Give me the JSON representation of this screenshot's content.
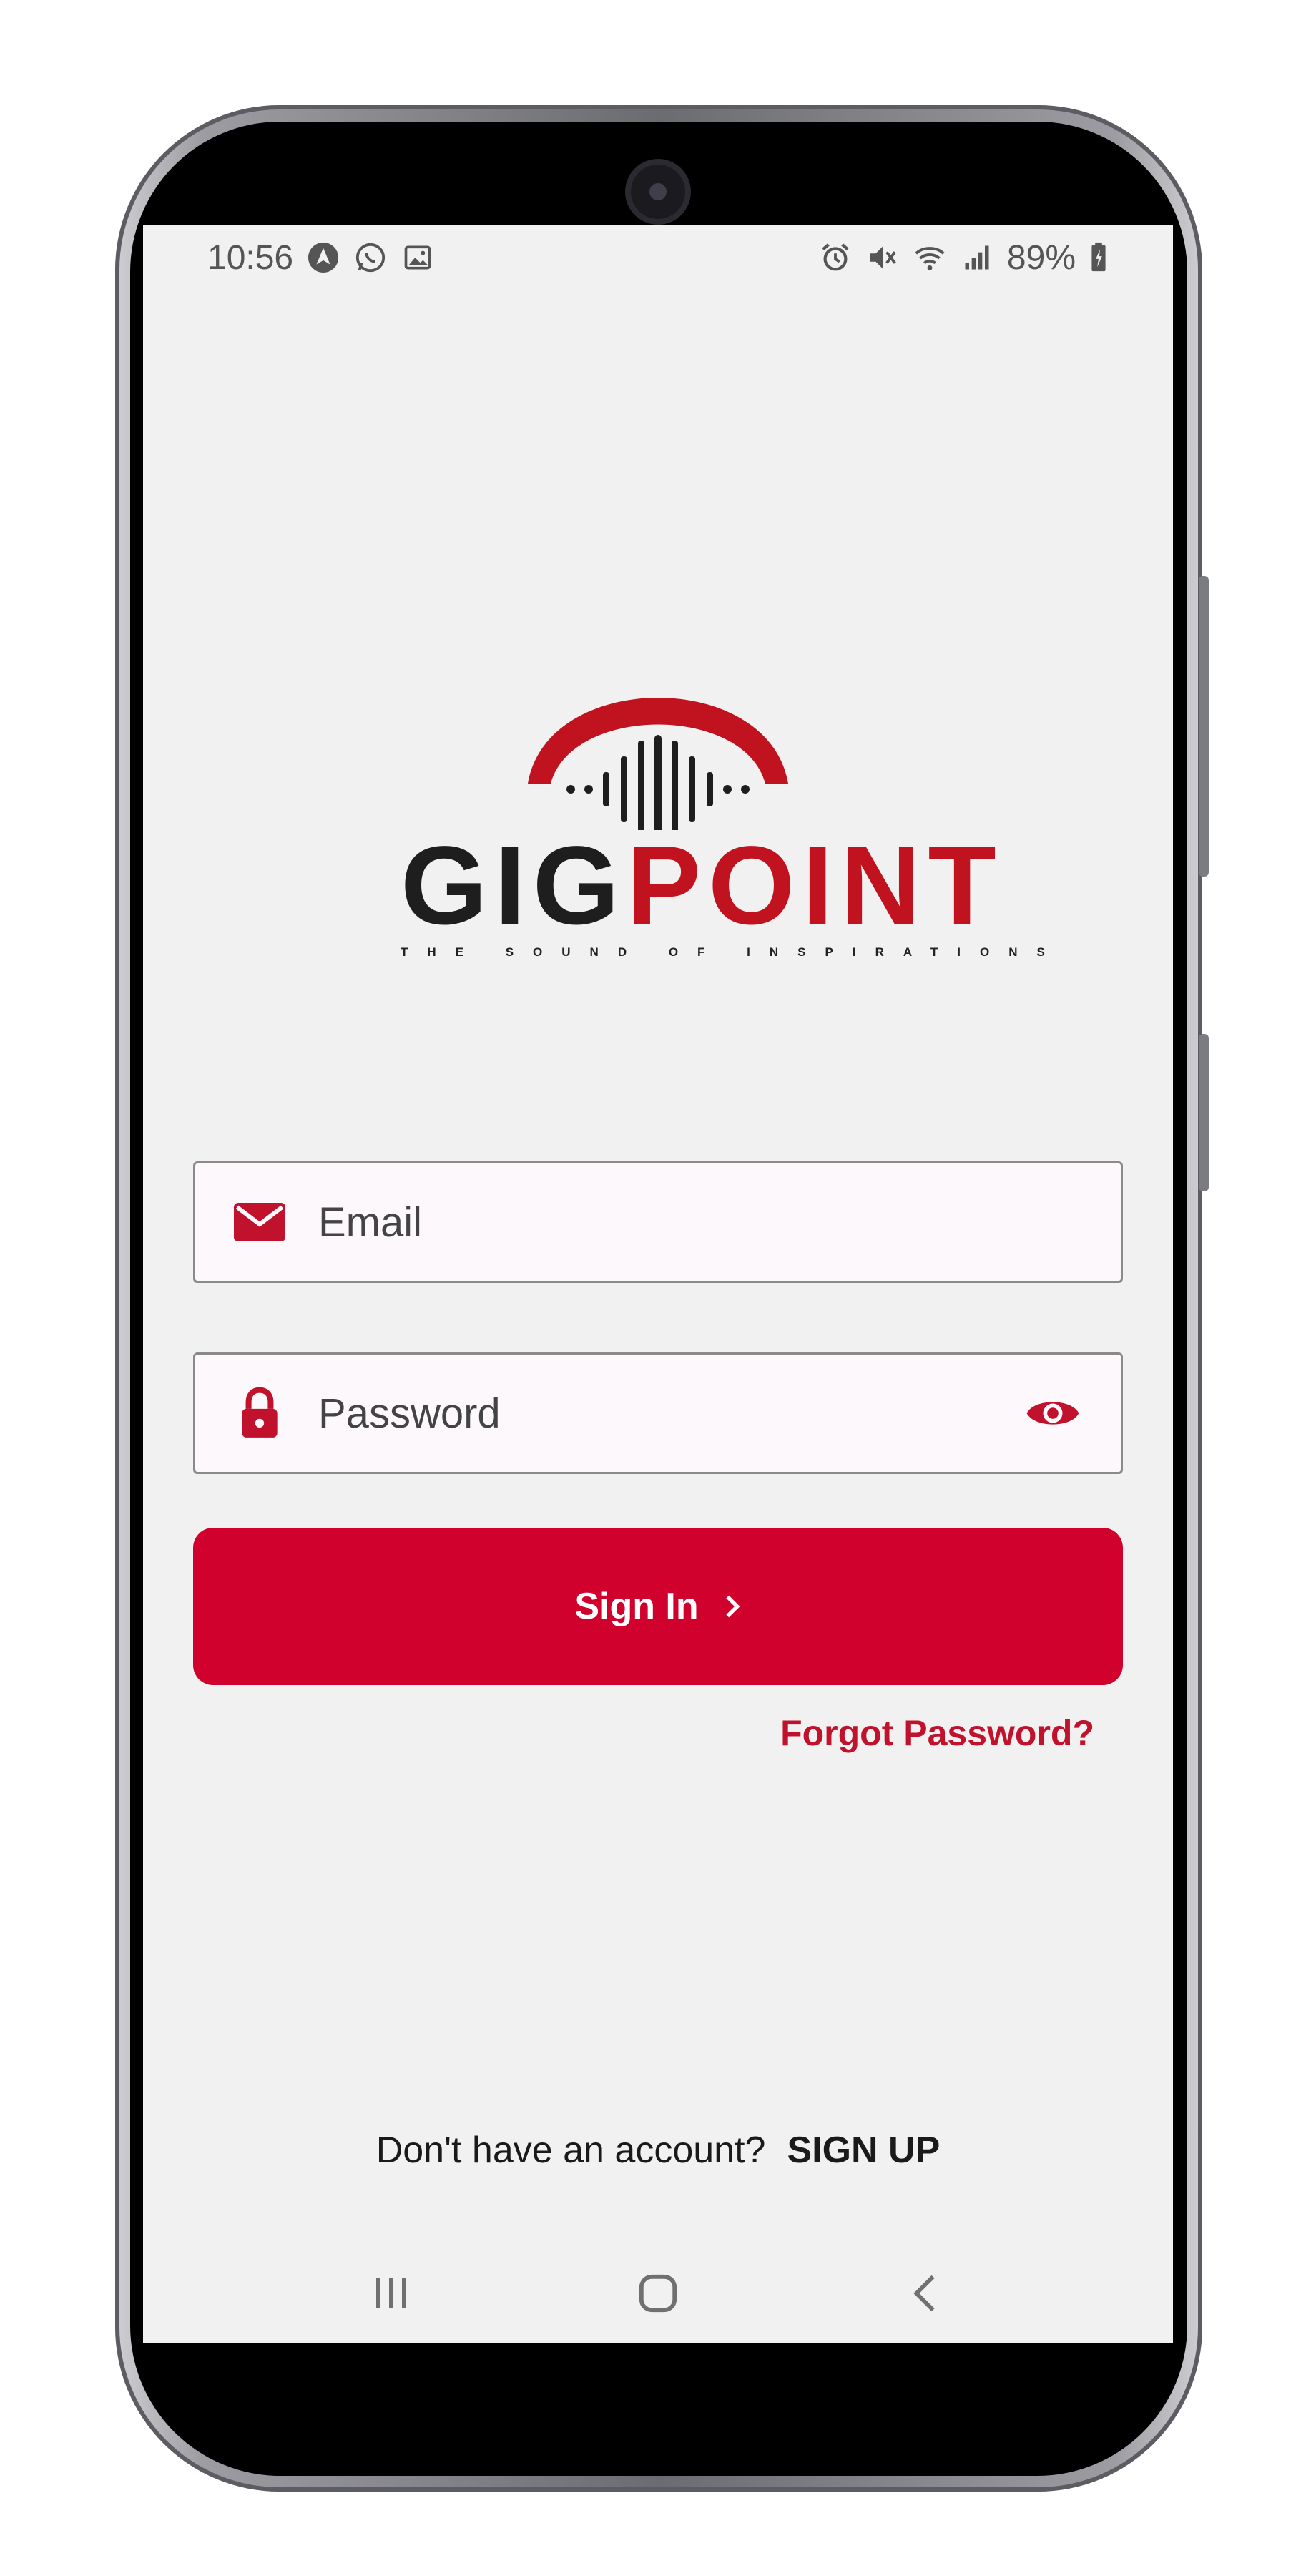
{
  "status_bar": {
    "time": "10:56",
    "battery": "89%",
    "left_icons": [
      "navigation-icon",
      "whatsapp-icon",
      "gallery-icon"
    ],
    "right_icons": [
      "alarm-icon",
      "mute-icon",
      "wifi-icon",
      "signal-icon",
      "battery-icon"
    ]
  },
  "logo": {
    "word_dark": "GIG",
    "word_red": "POINT",
    "tagline": "THE SOUND OF INSPIRATIONS"
  },
  "form": {
    "email_placeholder": "Email",
    "password_placeholder": "Password",
    "signin_label": "Sign In",
    "forgot_label": "Forgot Password?"
  },
  "footer": {
    "prompt": "Don't have an account?",
    "signup_label": "SIGN UP"
  },
  "colors": {
    "brand_red": "#d0022d",
    "background": "#f1f1f1",
    "logo_dark": "#1e1e1e"
  }
}
